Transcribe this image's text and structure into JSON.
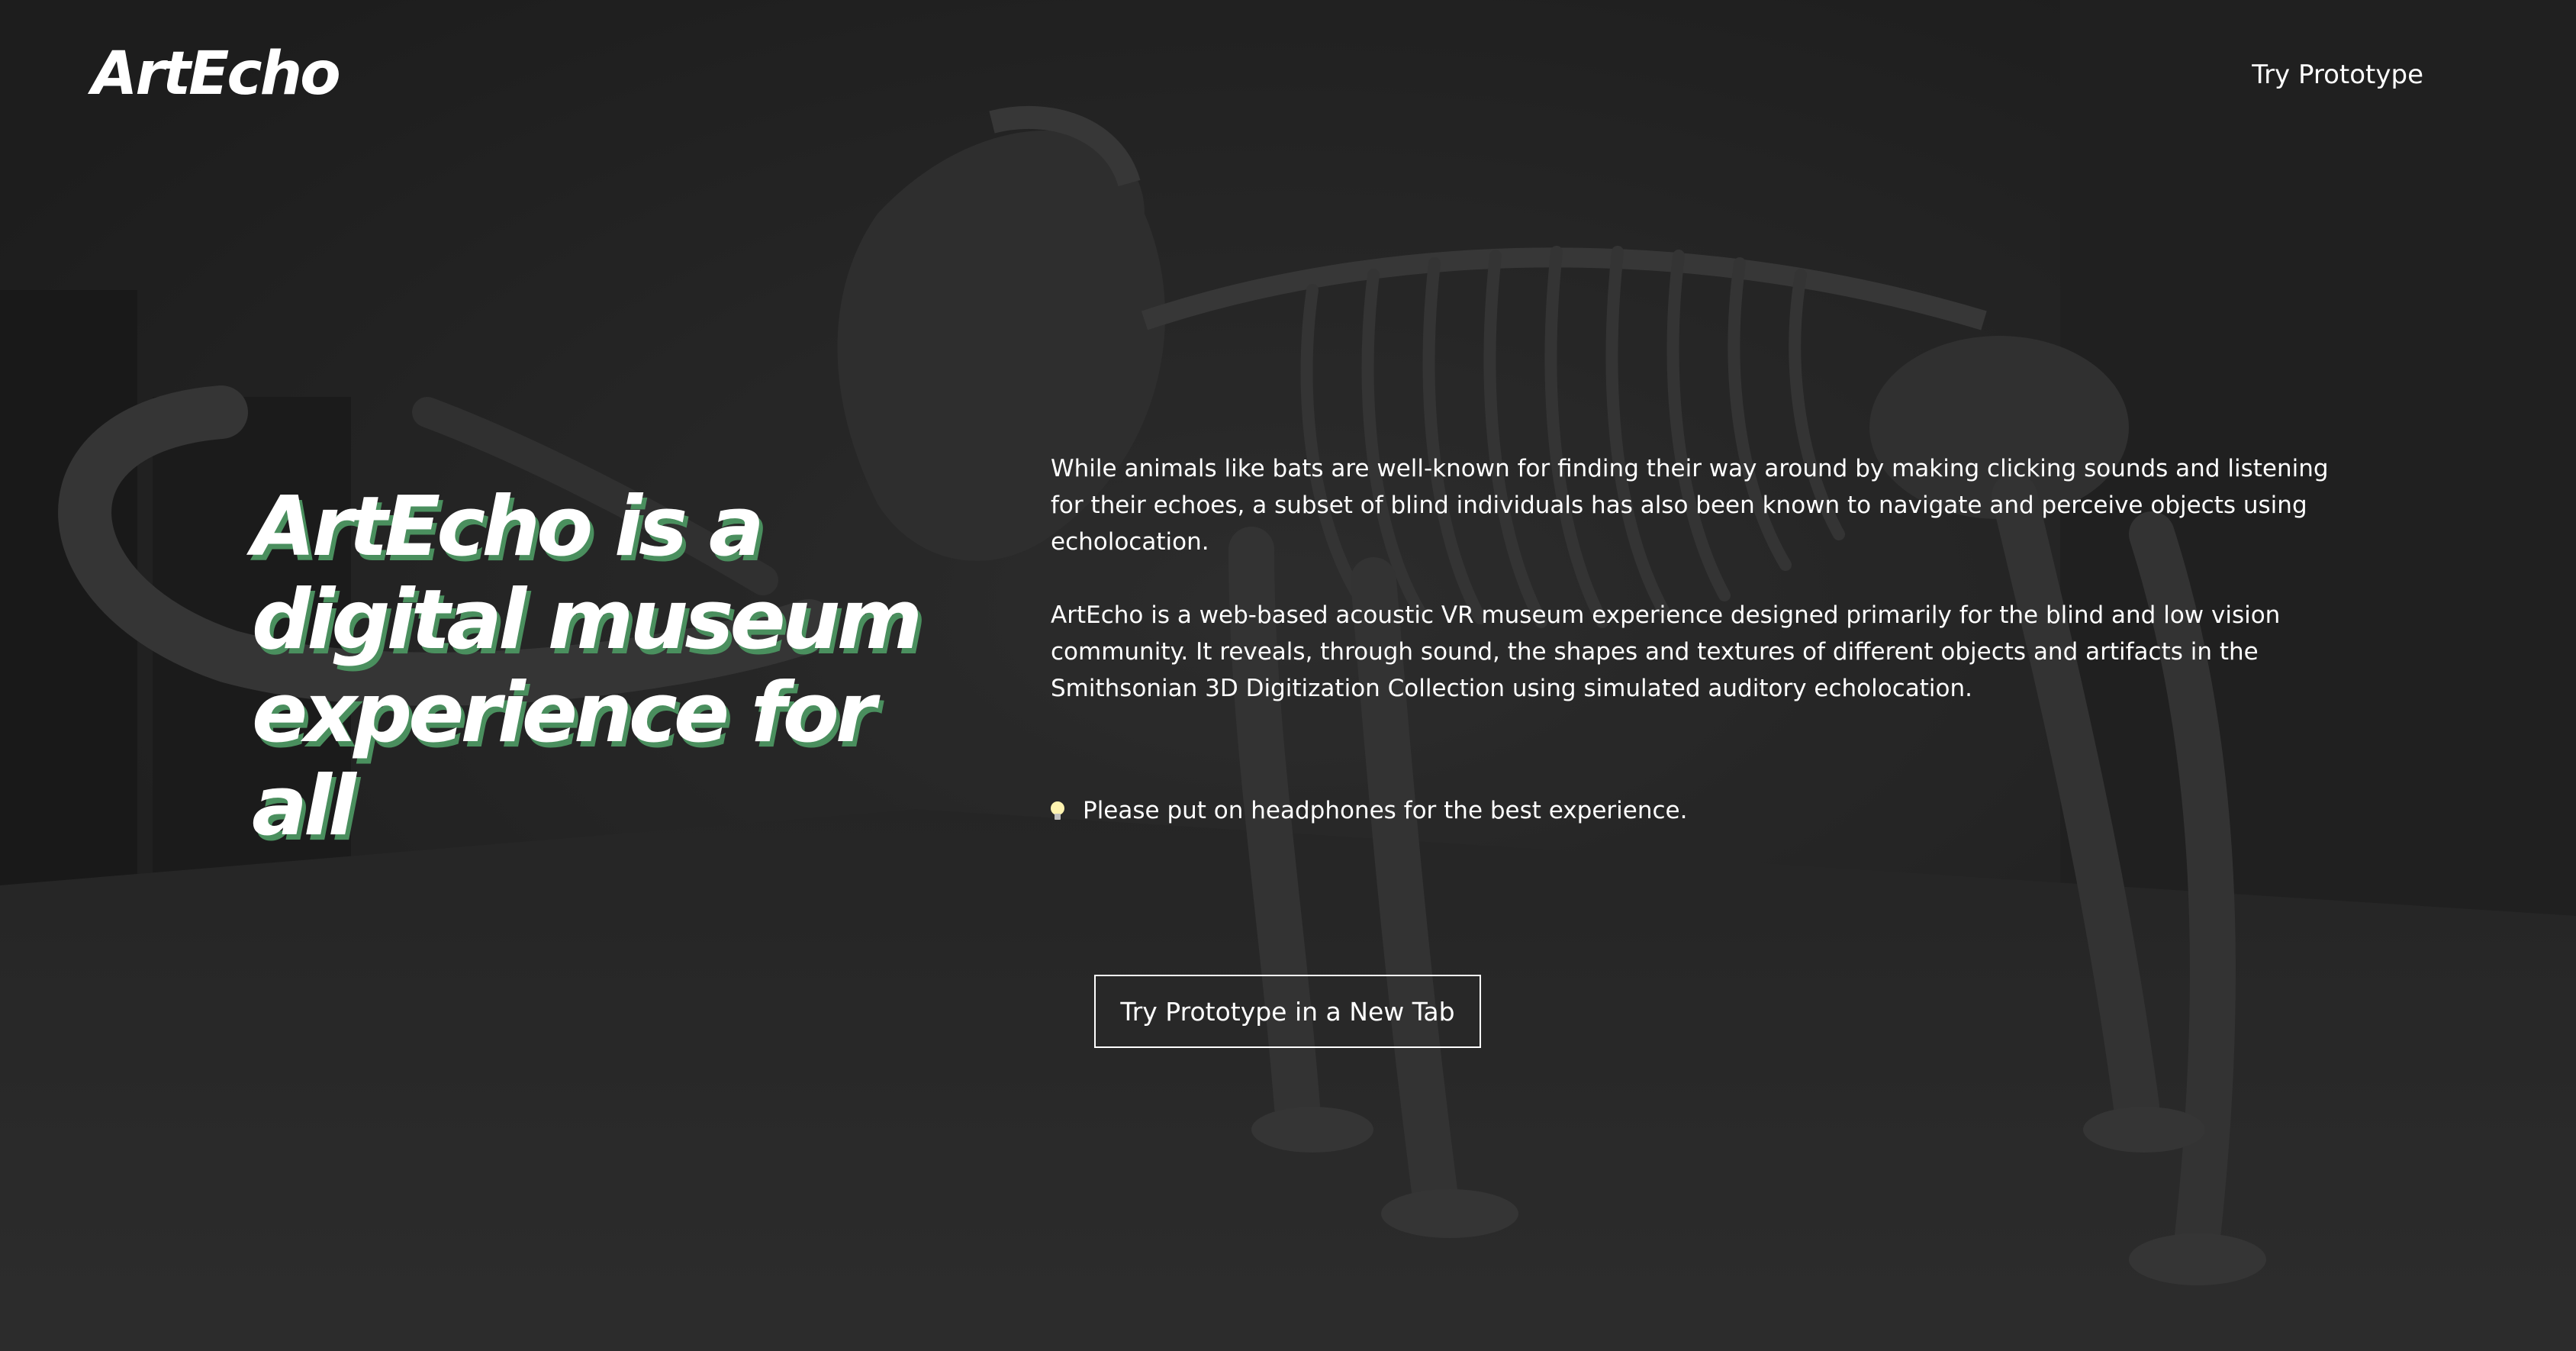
{
  "header": {
    "logo": "ArtEcho",
    "nav_link": "Try Prototype"
  },
  "hero": {
    "headline": "ArtEcho is a digital museum experience for all",
    "paragraphs": [
      "While animals like bats are well-known for finding their way around by making clicking sounds and listening for their echoes, a subset of blind individuals has also been known to navigate and perceive objects using echolocation.",
      "ArtEcho is a web-based acoustic VR museum experience designed primarily for the blind and low vision community. It reveals, through sound, the shapes and textures of different objects and artifacts in the Smithsonian 3D Digitization Collection using simulated auditory echolocation."
    ],
    "tip_icon": "lightbulb-icon",
    "tip": "Please put on headphones for the best experience.",
    "cta_label": "Try Prototype in a New Tab"
  },
  "colors": {
    "background": "#232323",
    "headline_shadow": "#4a8f5e",
    "text": "#ffffff"
  }
}
